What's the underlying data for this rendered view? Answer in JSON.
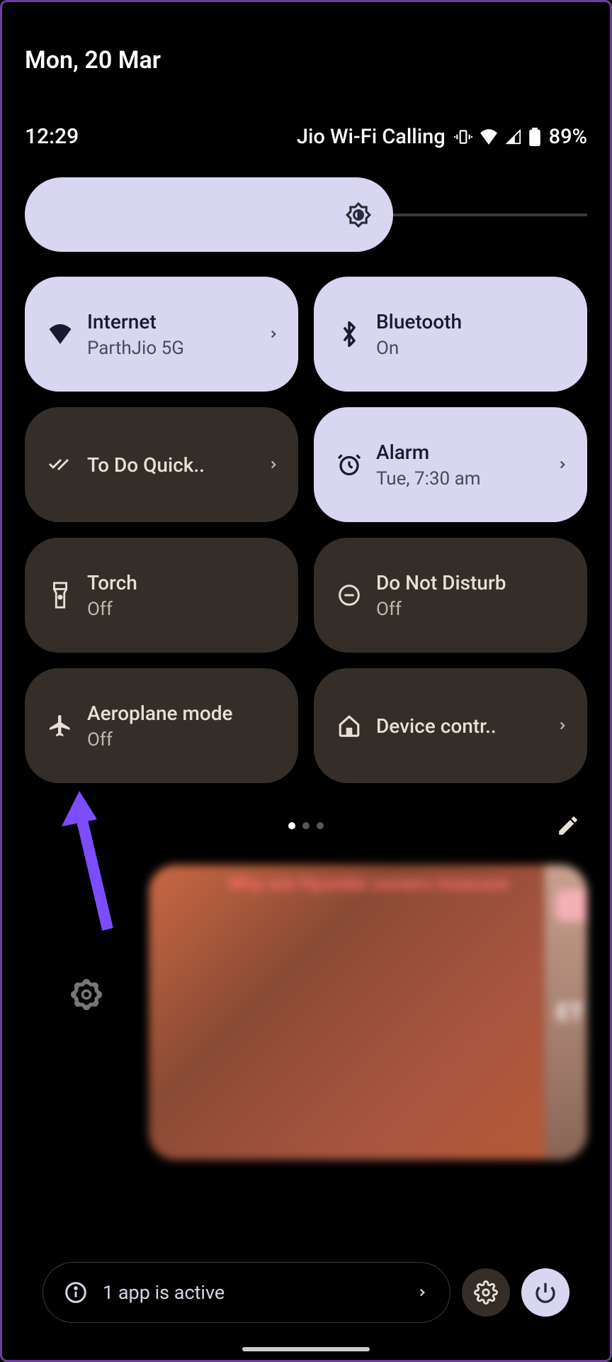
{
  "date": "Mon, 20 Mar",
  "status": {
    "time": "12:29",
    "carrier": "Jio Wi-Fi Calling",
    "battery": "89%"
  },
  "brightness": {
    "level": 65
  },
  "tiles": {
    "internet": {
      "title": "Internet",
      "subtitle": "ParthJio 5G"
    },
    "bluetooth": {
      "title": "Bluetooth",
      "subtitle": "On"
    },
    "todo": {
      "title": "To Do Quick.."
    },
    "alarm": {
      "title": "Alarm",
      "subtitle": "Tue, 7:30 am"
    },
    "torch": {
      "title": "Torch",
      "subtitle": "Off"
    },
    "dnd": {
      "title": "Do Not Disturb",
      "subtitle": "Off"
    },
    "airplane": {
      "title": "Aeroplane mode",
      "subtitle": "Off"
    },
    "device": {
      "title": "Device contr.."
    }
  },
  "notification": {
    "headline": "Why are Hyundai owners insecure",
    "side_text": "ET"
  },
  "footer": {
    "apps_active": "1 app is active"
  }
}
